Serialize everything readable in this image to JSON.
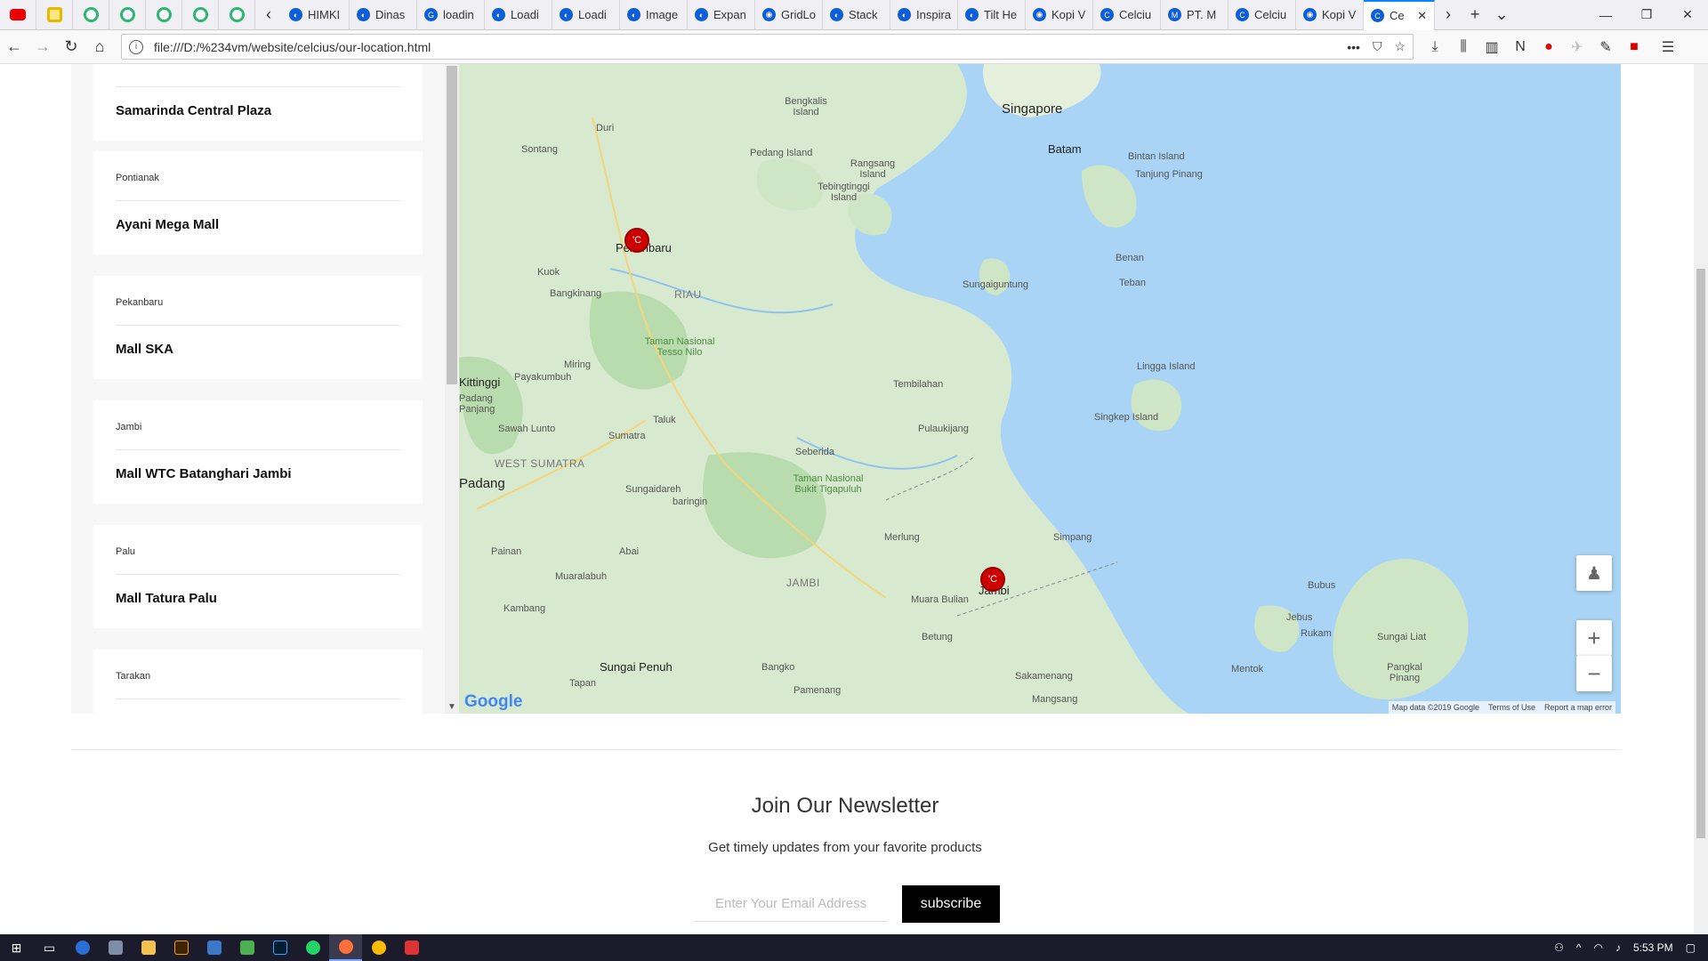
{
  "browser": {
    "pinned_tabs": [
      "youtube-icon",
      "notes-icon",
      "grammarly-icon",
      "grammarly-icon",
      "grammarly-icon",
      "grammarly-icon",
      "grammarly-icon",
      "grammarly-icon"
    ],
    "tabs": [
      {
        "label": "HIMKI"
      },
      {
        "label": "Dinas"
      },
      {
        "label": "loadin"
      },
      {
        "label": "Loadi"
      },
      {
        "label": "Loadi"
      },
      {
        "label": "Image"
      },
      {
        "label": "Expan"
      },
      {
        "label": "GridLo"
      },
      {
        "label": "Stack"
      },
      {
        "label": "Inspira"
      },
      {
        "label": "Tilt He"
      },
      {
        "label": "Kopi V"
      },
      {
        "label": "Celciu"
      },
      {
        "label": "PT. M"
      },
      {
        "label": "Celciu"
      },
      {
        "label": "Kopi V"
      },
      {
        "label": "Ce"
      }
    ],
    "url": "file:///D:/%234vm/website/celcius/our-location.html"
  },
  "locations": [
    {
      "city": "",
      "mall": "Samarinda Central Plaza"
    },
    {
      "city": "Pontianak",
      "mall": "Ayani Mega Mall"
    },
    {
      "city": "Pekanbaru",
      "mall": "Mall SKA"
    },
    {
      "city": "Jambi",
      "mall": "Mall WTC Batanghari Jambi"
    },
    {
      "city": "Palu",
      "mall": "Mall Tatura Palu"
    },
    {
      "city": "Tarakan",
      "mall": ""
    }
  ],
  "map": {
    "labels": {
      "singapore": "Singapore",
      "batam": "Batam",
      "bintan": "Bintan Island",
      "tanjung": "Tanjung Pinang",
      "bengkalis": "Bengkalis Island",
      "pedang": "Pedang Island",
      "rangsang": "Rangsang Island",
      "tebing": "Tebingtinggi Island",
      "duri": "Duri",
      "sontang": "Sontang",
      "pekanbaru": "Pekanbaru",
      "kuok": "Kuok",
      "bangkinang": "Bangkinang",
      "riau": "RIAU",
      "benan": "Benan",
      "teban": "Teban",
      "sungaiguntung": "Sungaiguntung",
      "tesso": "Taman Nasional Tesso Nilo",
      "miring": "Miring",
      "payakumbuh": "Payakumbuh",
      "lingga": "Lingga Island",
      "tembilahan": "Tembilahan",
      "singkep": "Singkep Island",
      "kittinggi": "Kittinggi",
      "padangpanjang": "Padang Panjang",
      "sawahlunto": "Sawah Lunto",
      "taluk": "Taluk",
      "sumatra": "Sumatra",
      "pulaukijang": "Pulaukijang",
      "westsumatra": "WEST SUMATRA",
      "seberida": "Seberida",
      "padang": "Padang",
      "bukit": "Taman Nasional Bukit Tigapuluh",
      "sungaidareh": "Sungaidareh",
      "baringin": "baringin",
      "merlung": "Merlung",
      "simpang": "Simpang",
      "painan": "Painan",
      "abai": "Abai",
      "muaralabuh": "Muaralabuh",
      "jambiregion": "JAMBI",
      "muarabulian": "Muara Bulian",
      "jambi": "Jambi",
      "bubus": "Bubus",
      "jebus": "Jebus",
      "rukam": "Rukam",
      "sungailiat": "Sungai Liat",
      "kambang": "Kambang",
      "betung": "Betung",
      "sungaipenuh": "Sungai Penuh",
      "bangko": "Bangko",
      "mentok": "Mentok",
      "pangkal": "Pangkal Pinang",
      "tapan": "Tapan",
      "pamenang": "Pamenang",
      "sakamenang": "Sakamenang",
      "mangsang": "Mangsang"
    },
    "marker_text": "'C",
    "zoom_in": "+",
    "zoom_out": "−",
    "logo": "Google",
    "attribution": {
      "data": "Map data ©2019 Google",
      "terms": "Terms of Use",
      "report": "Report a map error"
    }
  },
  "newsletter": {
    "title": "Join Our Newsletter",
    "subtitle": "Get timely updates from your favorite products",
    "email_placeholder": "Enter Your Email Address",
    "button": "subscribe"
  },
  "taskbar": {
    "time": "5:53 PM"
  }
}
